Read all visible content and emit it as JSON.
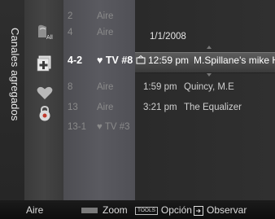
{
  "side_tab": {
    "label": "Canales agregados"
  },
  "channels": [
    {
      "number": "2",
      "name": "Aire",
      "selected": false
    },
    {
      "number": "4",
      "name": "Aire",
      "selected": false
    },
    {
      "number": "4-2",
      "name": "♥ TV #8",
      "selected": true
    },
    {
      "number": "8",
      "name": "Aire",
      "selected": false
    },
    {
      "number": "13",
      "name": "Aire",
      "selected": false
    },
    {
      "number": "13-1",
      "name": "♥ TV #3",
      "selected": false
    }
  ],
  "program": {
    "date": "1/1/2008",
    "selected": {
      "time": "12:59 pm",
      "title": "M.Spillane's mike Ha."
    },
    "items": [
      {
        "time": "1:59 pm",
        "title": "Quincy, M.E"
      },
      {
        "time": "3:21 pm",
        "title": "The Equalizer"
      }
    ]
  },
  "footer": {
    "mode": "Aire",
    "zoom_label": "Zoom",
    "tools_key": "TOOLS",
    "option_label": "Opción",
    "watch_label": "Observar"
  },
  "icons": [
    "all-channels-icon",
    "add-channel-icon",
    "favorite-heart-icon",
    "lock-icon"
  ],
  "colors": {
    "accent": "#ffffff",
    "muted": "#8a8a8a"
  }
}
